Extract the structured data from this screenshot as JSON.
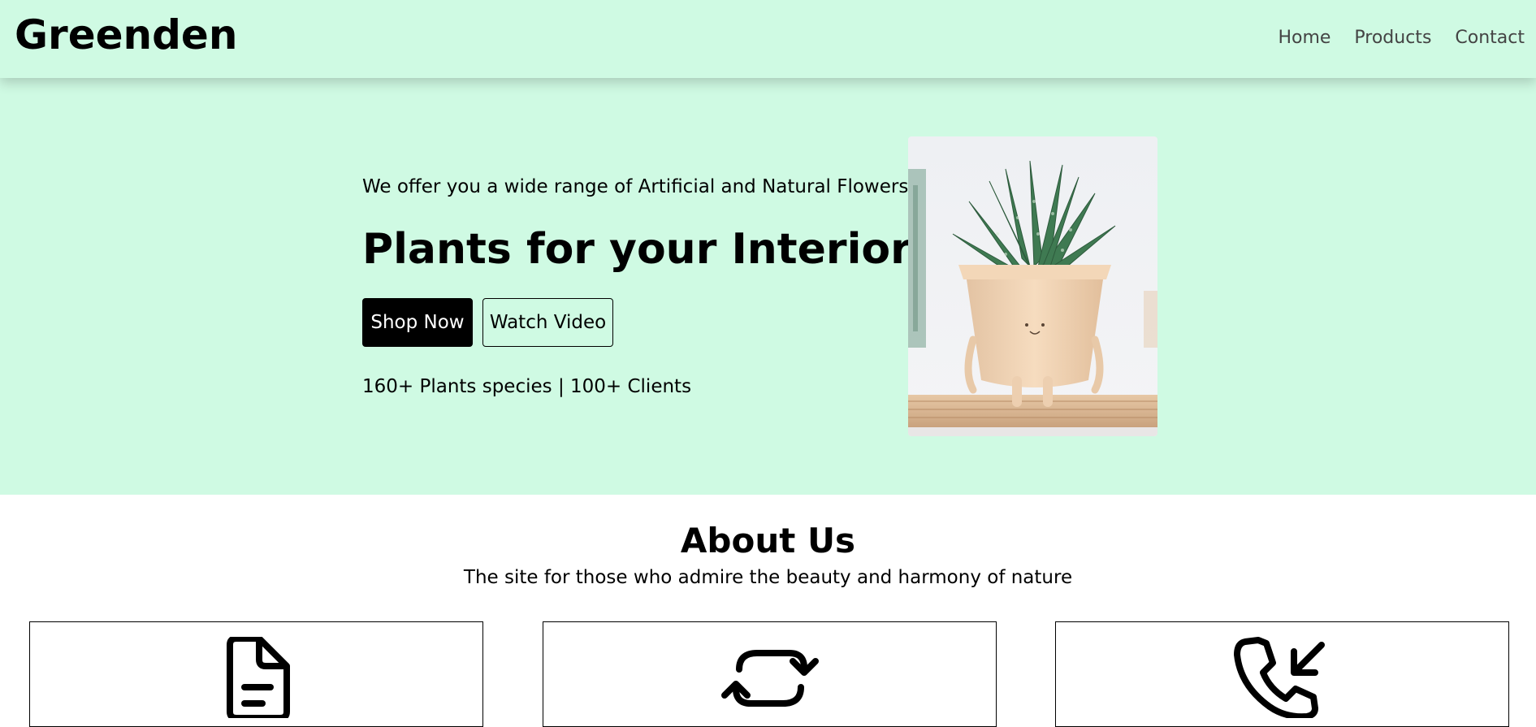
{
  "navbar": {
    "brand": "Greenden",
    "links": [
      "Home",
      "Products",
      "Contact"
    ],
    "background": "#cffae3"
  },
  "hero": {
    "tagline": "We offer you a wide range of Artificial and Natural Flowers",
    "headline": "Plants for your Interior",
    "shop_button": "Shop Now",
    "watch_button": "Watch Video",
    "stats": "160+ Plants species | 100+ Clients",
    "image_icon": "potted-succulent-image"
  },
  "about": {
    "title": "About Us",
    "subtitle": "The site for those who admire the beauty and harmony of nature",
    "cards": [
      {
        "icon": "document-icon"
      },
      {
        "icon": "refresh-icon"
      },
      {
        "icon": "incoming-call-icon"
      }
    ]
  }
}
